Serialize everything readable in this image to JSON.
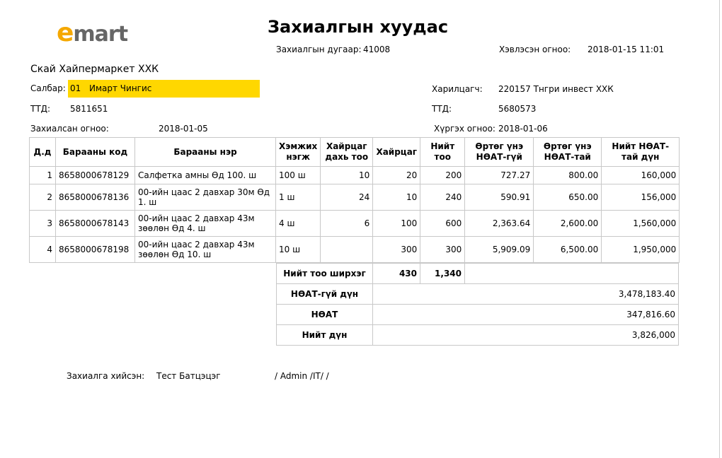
{
  "logo": {
    "e": "e",
    "rest": "mart"
  },
  "title": "Захиалгын хуудас",
  "order_no": {
    "label": "Захиалгын дугаар:",
    "value": "41008"
  },
  "printed": {
    "label": "Хэвлэсэн огноо:",
    "value": "2018-01-15 11:01"
  },
  "company": "Скай Хайпермаркет ХХК",
  "branch": {
    "label": "Салбар:",
    "code": "01",
    "name": "Имарт Чингис"
  },
  "tin_left": {
    "label": "ТТД:",
    "value": "5811651"
  },
  "order_date": {
    "label": "Захиалсан огноо:",
    "value": "2018-01-05"
  },
  "partner": {
    "label": "Харилцагч:",
    "value": "220157 Тнгри инвест ХХК"
  },
  "tin_right": {
    "label": "ТТД:",
    "value": "5680573"
  },
  "delivery": {
    "label": "Хүргэх огноо:",
    "value": "2018-01-06"
  },
  "columns": [
    "Д.д",
    "Барааны код",
    "Барааны нэр",
    "Хэмжих нэгж",
    "Хайрцаг дахь тоо",
    "Хайрцаг",
    "Нийт тоо",
    "Өртөг үнэ НӨАТ-гүй",
    "Өртөг үнэ НӨАТ-тай",
    "Нийт НӨАТ-тай дүн"
  ],
  "rows": [
    [
      "1",
      "8658000678129",
      "Салфетка амны  Өд 100. ш",
      "100 ш",
      "10",
      "20",
      "200",
      "727.27",
      "800.00",
      "160,000"
    ],
    [
      "2",
      "8658000678136",
      "00-ийн цаас 2 давхар 30м Өд 1. ш",
      "1 ш",
      "24",
      "10",
      "240",
      "590.91",
      "650.00",
      "156,000"
    ],
    [
      "3",
      "8658000678143",
      "00-ийн цаас 2 давхар 43м зөөлөн Өд 4. ш",
      "4 ш",
      "6",
      "100",
      "600",
      "2,363.64",
      "2,600.00",
      "1,560,000"
    ],
    [
      "4",
      "8658000678198",
      "00-ийн цаас 2 давхар 43м зөөлөн Өд 10. ш",
      "10 ш",
      "",
      "300",
      "300",
      "5,909.09",
      "6,500.00",
      "1,950,000"
    ]
  ],
  "totals": {
    "qty_label": "Нийт тоо ширхэг",
    "boxes": "430",
    "qty": "1,340",
    "novat_label": "НӨАТ-гүй дүн",
    "novat": "3,478,183.40",
    "vat_label": "НӨАТ",
    "vat": "347,816.60",
    "total_label": "Нийт дүн",
    "total": "3,826,000"
  },
  "orderer": {
    "label": "Захиалга хийсэн:",
    "name": "Тест Батцэцэг",
    "role": "/ Admin /IT/ /"
  }
}
